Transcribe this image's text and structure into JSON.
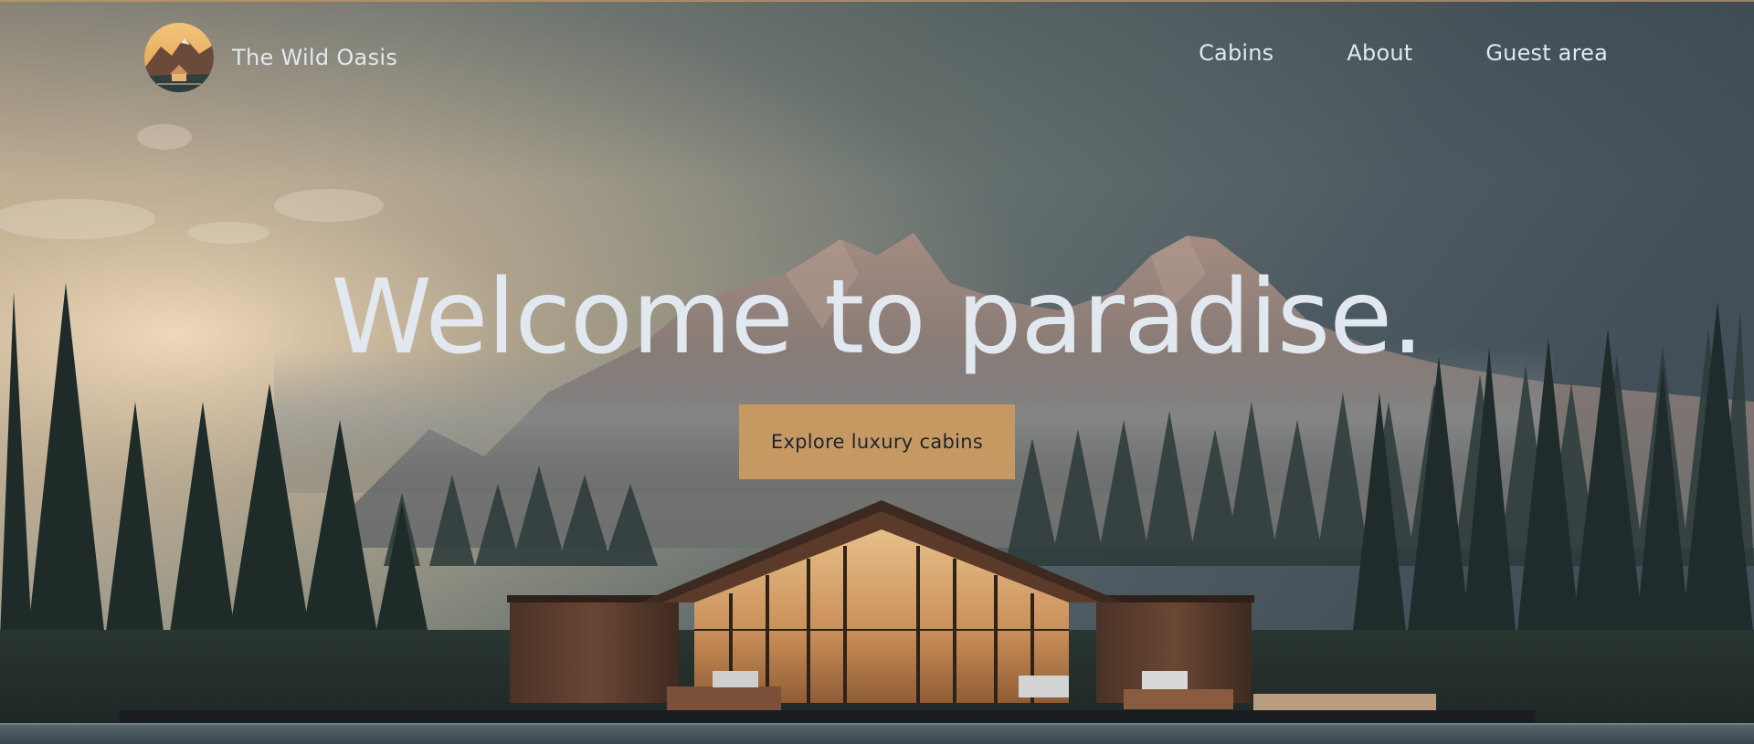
{
  "brand": {
    "name": "The Wild Oasis",
    "logo_icon": "cabin-logo-icon"
  },
  "nav": {
    "items": [
      {
        "label": "Cabins"
      },
      {
        "label": "About"
      },
      {
        "label": "Guest area"
      }
    ]
  },
  "hero": {
    "title": "Welcome to paradise.",
    "cta_label": "Explore luxury cabins",
    "background": "mountain-lake-cabin-photo"
  },
  "colors": {
    "accent": "#c69963",
    "text": "#e1e8ef",
    "cta_text": "#1b2631",
    "background_dark": "#141c24"
  }
}
